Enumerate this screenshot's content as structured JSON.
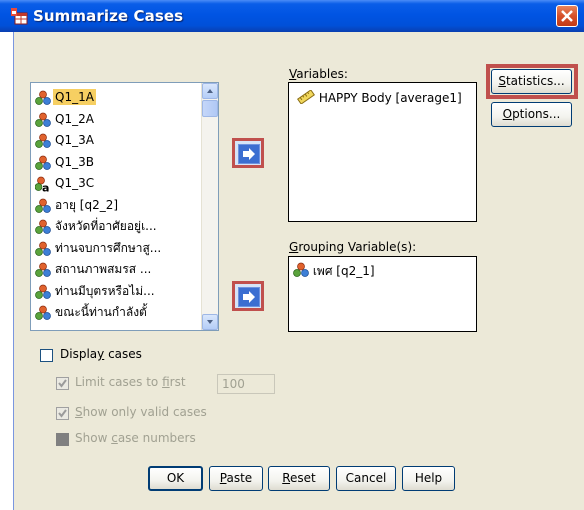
{
  "window": {
    "title": "Summarize Cases",
    "close_label": "X"
  },
  "source_list": {
    "items": [
      {
        "label": "Q1_1A",
        "icon": "nominal-variable-icon",
        "selected": true
      },
      {
        "label": "Q1_2A",
        "icon": "nominal-variable-icon"
      },
      {
        "label": "Q1_3A",
        "icon": "nominal-variable-icon"
      },
      {
        "label": "Q1_3B",
        "icon": "nominal-variable-icon"
      },
      {
        "label": "Q1_3C",
        "icon": "nominal-string-variable-icon"
      },
      {
        "label": "อายุ [q2_2]",
        "icon": "nominal-variable-icon"
      },
      {
        "label": "จังหวัดที่อาศัยอยู่เ...",
        "icon": "nominal-variable-icon"
      },
      {
        "label": "ท่านจบการศึกษาสู...",
        "icon": "nominal-variable-icon"
      },
      {
        "label": "สถานภาพสมรส ...",
        "icon": "nominal-variable-icon"
      },
      {
        "label": "ท่านมีบุตรหรือไม่...",
        "icon": "nominal-variable-icon"
      },
      {
        "label": "ขณะนี้ท่านกำลังตั้",
        "icon": "nominal-variable-icon"
      }
    ]
  },
  "variables": {
    "label_u": "V",
    "label_rest": "ariables:",
    "items": [
      {
        "label": "HAPPY Body [average1]",
        "icon": "scale-variable-icon"
      }
    ]
  },
  "grouping": {
    "label_u": "G",
    "label_rest": "rouping Variable(s):",
    "items": [
      {
        "label": "เพศ [q2_1]",
        "icon": "nominal-variable-icon"
      }
    ]
  },
  "side_buttons": {
    "statistics_u": "S",
    "statistics_rest": "tatistics...",
    "options_u": "O",
    "options_rest": "ptions..."
  },
  "options_section": {
    "display_cases": {
      "pre": "Displa",
      "u": "y",
      "post": " cases",
      "checked": false
    },
    "limit_cases": {
      "pre": "Limit cases to ",
      "u": "f",
      "post": "irst",
      "checked": true,
      "value": "100"
    },
    "show_valid": {
      "pre": "",
      "u": "S",
      "post": "how only valid cases",
      "checked": true
    },
    "show_numbers": {
      "pre": "Show ",
      "u": "c",
      "post": "ase numbers",
      "checked": false
    }
  },
  "bottom_buttons": {
    "ok": "OK",
    "paste_u": "P",
    "paste_rest": "aste",
    "reset_u": "R",
    "reset_rest": "eset",
    "cancel": "Cancel",
    "help": "Help"
  },
  "colors": {
    "titlebar": "#0054e3",
    "highlight": "#c0504d",
    "selection": "#f6cf62",
    "dialog_bg": "#ece9d8"
  }
}
